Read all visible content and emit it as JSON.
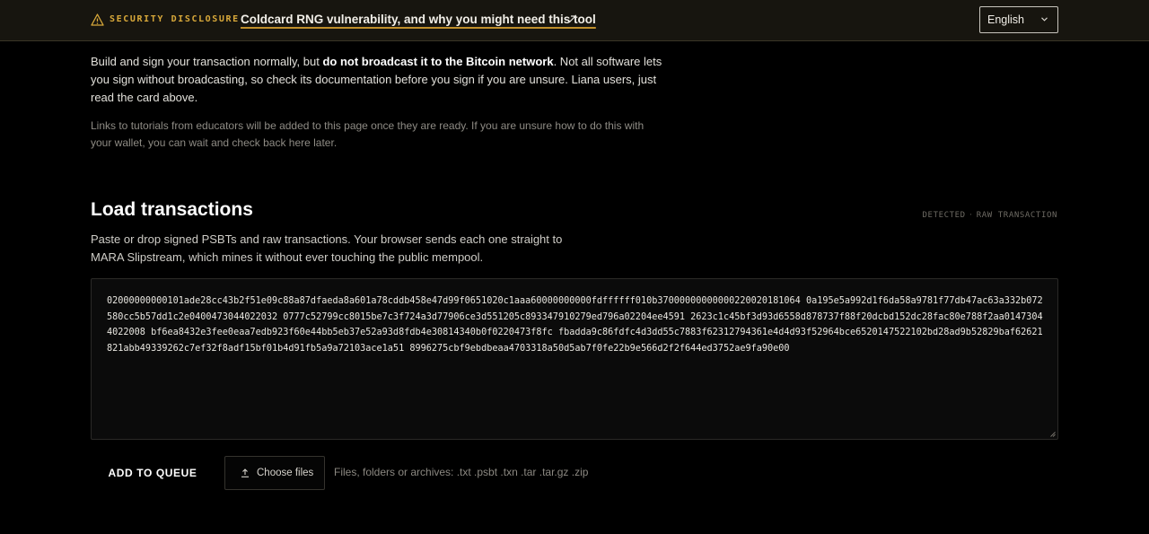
{
  "banner": {
    "label": "SECURITY DISCLOSURE",
    "link_text": "Coldcard RNG vulnerability, and why you might need this tool",
    "icon": "warning-icon",
    "link_icon": "external-link-icon",
    "accent_color": "#d9a93a"
  },
  "language": {
    "selected": "English"
  },
  "intro": {
    "text_before": "Build and sign your transaction normally, but ",
    "text_bold": "do not broadcast it to the Bitcoin network",
    "text_after": ". Not all software lets you sign without broadcasting, so check its documentation before you sign if you are unsure. Liana users, just read the card above."
  },
  "note": "Links to tutorials from educators will be added to this page once they are ready. If you are unsure how to do this with your wallet, you can wait and check back here later.",
  "load": {
    "title": "Load transactions",
    "detected_label": "DETECTED",
    "detected_value": "RAW TRANSACTION",
    "description": "Paste or drop signed PSBTs and raw transactions. Your browser sends each one straight to MARA Slipstream, which mines it without ever touching the public mempool.",
    "tx_value": "02000000000101ade28cc43b2f51e09c88a87dfaeda8a601a78cddb458e47d99f0651020c1aaa60000000000fdffffff010b37000000000000220020181064 0a195e5a992d1f6da58a9781f77db47ac63a332b072580cc5b57dd1c2e0400473044022032 0777c52799cc8015be7c3f724a3d77906ce3d551205c893347910279ed796a02204ee4591 2623c1c45bf3d93d6558d878737f88f20dcbd152dc28fac80e788f2aa01473044022008 bf6ea8432e3fee0eaa7edb923f60e44bb5eb37e52a93d8fdb4e30814340b0f0220473f8fc fbadda9c86fdfc4d3dd55c7883f62312794361e4d4d93f52964bce6520147522102bd28ad9b52829baf62621821abb49339262c7ef32f8adf15bf01b4d91fb5a9a72103ace1a51 8996275cbf9ebdbeaa4703318a50d5ab7f0fe22b9e566d2f2f644ed3752ae9fa90e00"
  },
  "actions": {
    "add_label": "ADD TO QUEUE",
    "choose_label": "Choose files",
    "choose_icon": "upload-icon",
    "hint": "Files, folders or archives: .txt .psbt .txn .tar .tar.gz .zip"
  }
}
